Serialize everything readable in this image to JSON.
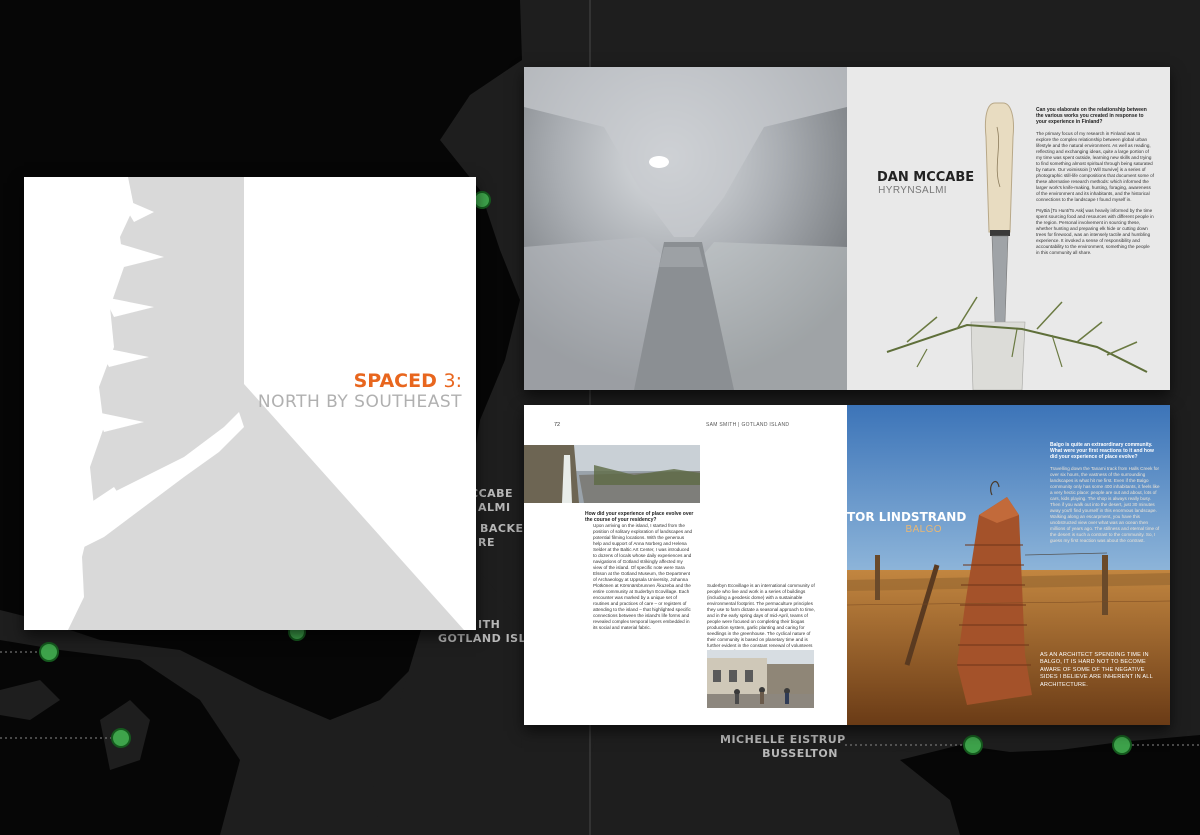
{
  "map": {
    "colors": {
      "ocean": "#1e1e1e",
      "land": "#050505",
      "marker": "#3ea34b",
      "line": "#8a8a8a"
    },
    "labels": [
      {
        "lines": [
          "CCABE",
          "ALMI"
        ]
      },
      {
        "lines": [
          "BACKEN",
          "RE"
        ]
      },
      {
        "lines": [
          "ITH",
          "GOTLAND ISLAND"
        ]
      },
      {
        "lines": [
          "MICHELLE EISTRUP",
          "BUSSELTON"
        ]
      }
    ]
  },
  "cover": {
    "title_main": "SPACED",
    "title_number": "3:",
    "subtitle": "NORTH BY SOUTHEAST",
    "colors": {
      "accent": "#e8661e",
      "land": "#d9d9d9",
      "paper": "#ffffff"
    }
  },
  "spread1": {
    "photo_left": "ice-tunnel-photo",
    "artist_name": "DAN MCCABE",
    "artist_place": "HYRYNSALMI",
    "photo_right": "knife-and-twig-photo",
    "question": "Can you elaborate on the relationship between the various works you created in response to your experience in Finland?",
    "paragraphs": [
      "The primary focus of my research in Finland was to explore the complex relationship between global urban lifestyle and the natural environment. As well as reading, reflecting and exchanging ideas, quite a large portion of my time was spent outside, learning new skills and trying to find something almost spiritual through being saturated by nature. Our voimissoin [I Will Survive] is a series of photographic still-life compositions that document some of these alternative research methods: which informed the larger work's knife-making, hunting, foraging, awareness of the environment and its inhabitants, and the historical connections to the landscape I found myself in.",
      "Psyttiä [To Hunt/To Ask] was heavily informed by the time spent sourcing food and resources with different people in the region. Personal involvement in sourcing these, whether hunting and preparing elk hide or cutting down trees for firewood, was an intensely tactile and humbling experience. It invoked a sense of responsibility and accountability to the environment, something the people in this community all share."
    ]
  },
  "spread2": {
    "page_number": "72",
    "running_head": "SAM SMITH | GOTLAND ISLAND",
    "photo_top": "coastal-cliff-waterfall-photo",
    "photo_bottom": "street-scene-photo",
    "question": "How did your experience of place evolve over the course of your residency?",
    "col1": "Upon arriving on the island, I started from the position of solitary exploration of landscapes and potential filming locations. With the generous help and support of Anna Norberg and Helena Selder at the Baltic Art Center, I was introduced to dozens of locals whose daily experiences and navigations of Gotland strikingly affected my view of the island. Of specific note were Sara Elsson at the Gotland Museum, the Department of Archaeology at Uppsala University, Johanna Plotkönen at Körsnärsbrunnen Åkuzeba and the entire community at Suderbyn Ecovillage. Each encounter was marked by a unique set of routines and practices of care – or registers of attending to the island – that highlighted specific connections between the island's life forms and revealed complex temporal layers embedded in its social and material fabric.",
    "col2": "Suderbyn Ecovillage is an international community of people who live and work in a series of buildings (including a geodesic dome) with a sustainable environmental footprint. The permaculture principles they use to farm dictate a seasonal approach to time, and in the early spring days of mid-April, teams of people were focused on completing their biogas production system, garlic planting and caring for seedlings in the greenhouse. The cyclical nature of their community is based on planetary time and is further evident in the constant renewal of volunteers who come to learn.",
    "artist_name": "TOR LINDSTRAND",
    "artist_place": "BALGO",
    "right_question": "Balgo is quite an extraordinary community. What were your first reactions to it and how did your experience of place evolve?",
    "right_text": "Travelling down the Tanami track from Halls Creek for over six hours, the vastness of the surrounding landscapes is what hit me first. Even if the Balgo community only has some 400 inhabitants, it feels like a very hectic place: people are out and about, lots of cars, kids playing. The shop is always really busy. Then if you walk out into the desert, just 30 minutes away you'll find yourself in this enormous landscape. Walking along an escarpment, you have this unobstructed view over what was an ocean then millions of years ago. The stillness and eternal time of the desert is such a contrast to the community. So, I guess my first reaction was about the contrast.",
    "pull_quote": "AS AN ARCHITECT SPENDING TIME IN BALGO, IT IS HARD NOT TO BECOME AWARE OF SOME OF THE NEGATIVE SIDES I BELIEVE ARE INHERENT IN ALL ARCHITECTURE."
  }
}
